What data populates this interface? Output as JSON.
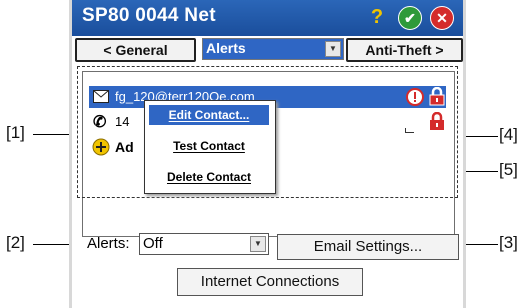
{
  "window": {
    "title": "SP80 0044 Net"
  },
  "titlebar_icons": [
    {
      "name": "help-icon",
      "glyph": "?"
    },
    {
      "name": "ok-icon",
      "glyph": "✔"
    },
    {
      "name": "close-icon",
      "glyph": "✕"
    }
  ],
  "tabs": {
    "prev_label": "< General",
    "current_label": "Alerts",
    "next_label": "Anti-Theft >"
  },
  "contacts": [
    {
      "type": "email",
      "label": "fg_120@terr120Oe.com",
      "icon": "envelope-icon",
      "selected": true
    },
    {
      "type": "phone",
      "label": "14",
      "icon": "phone-icon",
      "selected": false
    },
    {
      "type": "add",
      "label": "Ad",
      "icon": "add-icon",
      "selected": false
    }
  ],
  "context_menu": {
    "items": [
      "Edit Contact...",
      "Test Contact",
      "Delete Contact"
    ],
    "highlighted_index": 0
  },
  "alerts": {
    "label": "Alerts:",
    "value": "Off"
  },
  "buttons": {
    "email_settings": "Email Settings...",
    "internet_connections": "Internet Connections"
  },
  "callouts": {
    "c1": "[1]",
    "c2": "[2]",
    "c3": "[3]",
    "c4": "[4]",
    "c5": "[5]"
  },
  "colors": {
    "title_bar": "#1f57a8",
    "selection": "#2f66c4",
    "alert_red": "#d42b2b",
    "ok_green": "#2f9a3a",
    "add_yellow": "#f0c400"
  }
}
